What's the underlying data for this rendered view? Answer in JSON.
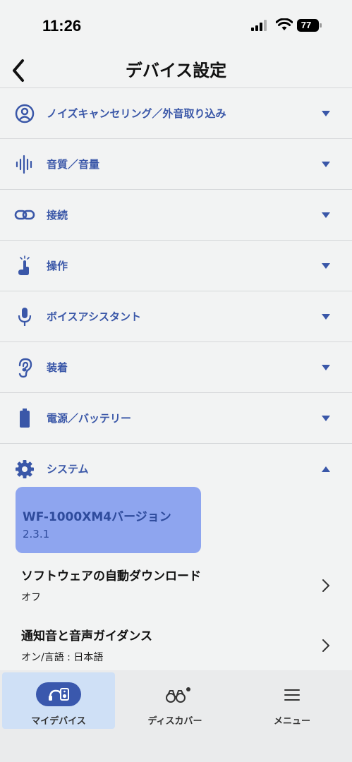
{
  "status_bar": {
    "time": "11:26",
    "battery_level": "77",
    "icons": [
      "signal-icon",
      "wifi-icon",
      "battery-icon"
    ]
  },
  "header": {
    "title": "デバイス設定",
    "back_icon": "back-chevron-icon"
  },
  "sections": [
    {
      "label": "ノイズキャンセリング／外音取り込み",
      "icon": "person-in-circle-icon",
      "expanded": false
    },
    {
      "label": "音質／音量",
      "icon": "sound-wave-icon",
      "expanded": false
    },
    {
      "label": "接続",
      "icon": "link-icon",
      "expanded": false
    },
    {
      "label": "操作",
      "icon": "tap-finger-icon",
      "expanded": false
    },
    {
      "label": "ボイスアシスタント",
      "icon": "microphone-icon",
      "expanded": false
    },
    {
      "label": "装着",
      "icon": "ear-icon",
      "expanded": false
    },
    {
      "label": "電源／バッテリー",
      "icon": "battery-icon",
      "expanded": false
    },
    {
      "label": "システム",
      "icon": "gear-icon",
      "expanded": true
    }
  ],
  "system": {
    "version_card": {
      "title": "WF-1000XM4バージョン",
      "value": "2.3.1"
    },
    "items": [
      {
        "title": "ソフトウェアの自動ダウンロード",
        "value": "オフ"
      },
      {
        "title": "通知音と音声ガイダンス",
        "value": "オン/言語 : 日本語"
      }
    ]
  },
  "tab_bar": {
    "tabs": [
      {
        "label": "マイデバイス",
        "icon": "headphones-device-icon",
        "active": true
      },
      {
        "label": "ディスカバー",
        "icon": "binoculars-icon",
        "active": false,
        "badge": true
      },
      {
        "label": "メニュー",
        "icon": "hamburger-menu-icon",
        "active": false
      }
    ]
  },
  "colors": {
    "accent": "#3a57a8",
    "version_card": "#8ea5ef",
    "active_tab_bg": "#cfe0f6",
    "background": "#f2f3f3"
  }
}
